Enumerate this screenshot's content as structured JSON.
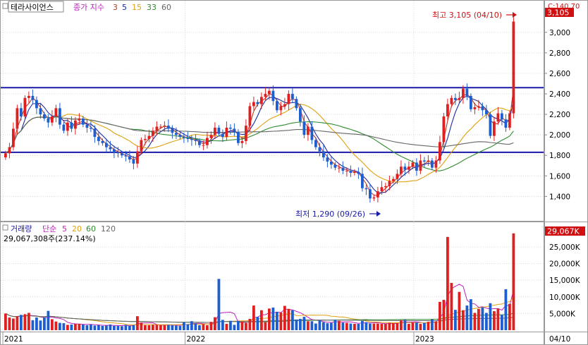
{
  "price_panel": {
    "stock_name": "테라사이언스",
    "ma_label": "종가 지수",
    "ma_periods": [
      "3",
      "5",
      "15",
      "33",
      "60"
    ],
    "ma_colors": [
      "#c0392b",
      "#1b2a9e",
      "#e0a010",
      "#2e8b2e",
      "#666666"
    ],
    "last_price_tag": "3,105",
    "corner_label": "C:140.70",
    "high_annotation": "최고 3,105 (04/10)",
    "low_annotation": "최저 1,290 (09/26)",
    "y_ticks": [
      "3,000",
      "2,800",
      "2,600",
      "2,400",
      "2,200",
      "2,000",
      "1,800",
      "1,600",
      "1,400"
    ],
    "y_tick_values": [
      3000,
      2800,
      2600,
      2400,
      2200,
      2000,
      1800,
      1600,
      1400
    ],
    "ylim": [
      1210,
      3205
    ],
    "support_line": 1830,
    "resistance_line": 2460
  },
  "volume_panel": {
    "title": "거래량",
    "ma_label": "단순",
    "ma_periods": [
      "5",
      "20",
      "60",
      "120"
    ],
    "ma_colors": [
      "#c020c0",
      "#e0a010",
      "#2e8b2e",
      "#666666"
    ],
    "total_value": "29,067,308주(237.14%)",
    "last_volume_tag": "29,067K",
    "y_ticks": [
      "25,000K",
      "20,000K",
      "15,000K",
      "10,000K",
      "5,000K"
    ],
    "y_tick_values": [
      25000,
      20000,
      15000,
      10000,
      5000
    ],
    "ylim": [
      0,
      30500
    ]
  },
  "x_axis": {
    "labels": [
      "2021",
      "2022",
      "2023",
      "04/10"
    ],
    "positions_index": [
      0,
      47,
      106,
      132
    ]
  },
  "colors": {
    "up": "#e02020",
    "down": "#1d5fd1",
    "level_line": "#1a1aa8"
  },
  "chart_data": {
    "type": "candlestick",
    "title": "테라사이언스",
    "close": [
      1820,
      1880,
      2060,
      2260,
      2180,
      2360,
      2380,
      2340,
      2260,
      2200,
      2160,
      2120,
      2180,
      2260,
      2100,
      2040,
      2120,
      2060,
      2140,
      2160,
      2100,
      2070,
      2060,
      1980,
      1940,
      1920,
      1880,
      1860,
      1830,
      1820,
      1800,
      1790,
      1760,
      1720,
      1840,
      1950,
      1960,
      1990,
      2040,
      2080,
      2080,
      2090,
      2060,
      2020,
      2000,
      1980,
      1970,
      1960,
      1950,
      1940,
      1900,
      1900,
      1970,
      2000,
      2070,
      2010,
      1980,
      2070,
      2060,
      2030,
      1920,
      1940,
      2090,
      2280,
      2320,
      2300,
      2370,
      2400,
      2430,
      2330,
      2240,
      2280,
      2300,
      2400,
      2350,
      2260,
      2130,
      2000,
      2080,
      1950,
      1880,
      1840,
      1780,
      1740,
      1710,
      1680,
      1680,
      1650,
      1650,
      1630,
      1640,
      1620,
      1480,
      1470,
      1380,
      1390,
      1450,
      1490,
      1500,
      1550,
      1570,
      1620,
      1690,
      1660,
      1690,
      1730,
      1650,
      1750,
      1740,
      1750,
      1680,
      1750,
      1930,
      2180,
      2300,
      2360,
      2340,
      2360,
      2450,
      2380,
      2250,
      2270,
      2280,
      2240,
      2200,
      1990,
      2130,
      2210,
      2150,
      2070,
      2210,
      3105
    ],
    "volume_k": [
      5000,
      3800,
      3500,
      4200,
      4600,
      4800,
      5200,
      3000,
      3800,
      2900,
      3800,
      5800,
      3300,
      2600,
      2200,
      2100,
      1600,
      1700,
      1900,
      1900,
      1700,
      1500,
      1700,
      1400,
      1500,
      1300,
      1400,
      1700,
      1300,
      1300,
      1200,
      1600,
      1300,
      1500,
      4200,
      2300,
      1500,
      1500,
      1600,
      1600,
      1500,
      1500,
      1600,
      1500,
      1400,
      1300,
      2400,
      1800,
      2700,
      2000,
      1500,
      1800,
      1500,
      2500,
      3900,
      15400,
      3100,
      1900,
      2800,
      1600,
      2800,
      2600,
      2200,
      3400,
      7400,
      4000,
      6000,
      2400,
      6500,
      6800,
      5500,
      5300,
      7300,
      6400,
      6000,
      3200,
      3400,
      4000,
      2700,
      2700,
      2000,
      2900,
      2400,
      2100,
      2200,
      3100,
      2800,
      2300,
      2200,
      2000,
      1900,
      1900,
      2800,
      2400,
      2000,
      2000,
      2000,
      1900,
      1900,
      2200,
      2100,
      2100,
      3000,
      3100,
      1900,
      2300,
      2300,
      1900,
      2200,
      2500,
      3200,
      2600,
      8500,
      9100,
      28000,
      14200,
      6100,
      11500,
      6000,
      7400,
      9300,
      5200,
      6400,
      6900,
      5200,
      8100,
      5700,
      6500,
      4600,
      12300,
      7900,
      29067
    ]
  }
}
